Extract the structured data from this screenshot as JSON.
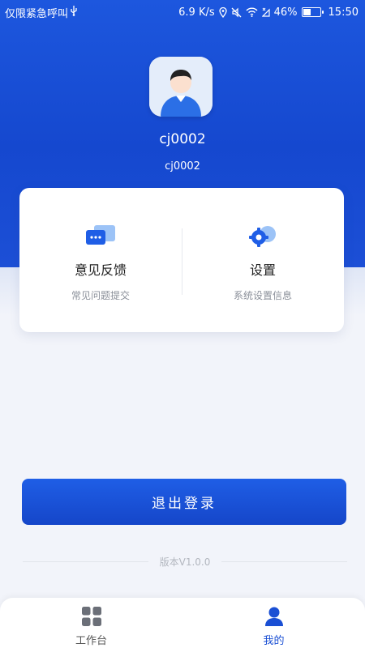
{
  "status_bar": {
    "carrier": "仅限紧急呼叫",
    "usb_icon": "usb-icon",
    "speed": "6.9 K/s",
    "battery": "46%",
    "time": "15:50"
  },
  "profile": {
    "name": "cj0002",
    "id": "cj0002"
  },
  "menu": [
    {
      "title": "意见反馈",
      "subtitle": "常见问题提交",
      "icon": "feedback-icon"
    },
    {
      "title": "设置",
      "subtitle": "系统设置信息",
      "icon": "settings-icon"
    }
  ],
  "logout_label": "退出登录",
  "version": "版本V1.0.0",
  "tabs": [
    {
      "label": "工作台",
      "icon": "grid-icon",
      "active": false
    },
    {
      "label": "我的",
      "icon": "user-icon",
      "active": true
    }
  ],
  "colors": {
    "primary": "#1a4fd4",
    "background": "#f2f4fa"
  }
}
